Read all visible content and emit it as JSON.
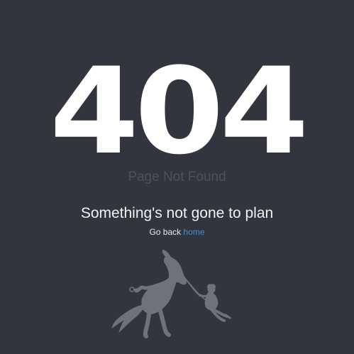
{
  "error": {
    "code": "404",
    "subtitle": "Page Not Found"
  },
  "message": {
    "headline": "Something's not gone to plan",
    "back_prefix": "Go back",
    "home_link": "home"
  },
  "illustration": {
    "icon": "horse-pulling-person-icon",
    "color": "#6e737b"
  },
  "colors": {
    "background": "#32353d",
    "link": "#3d8fd6"
  }
}
